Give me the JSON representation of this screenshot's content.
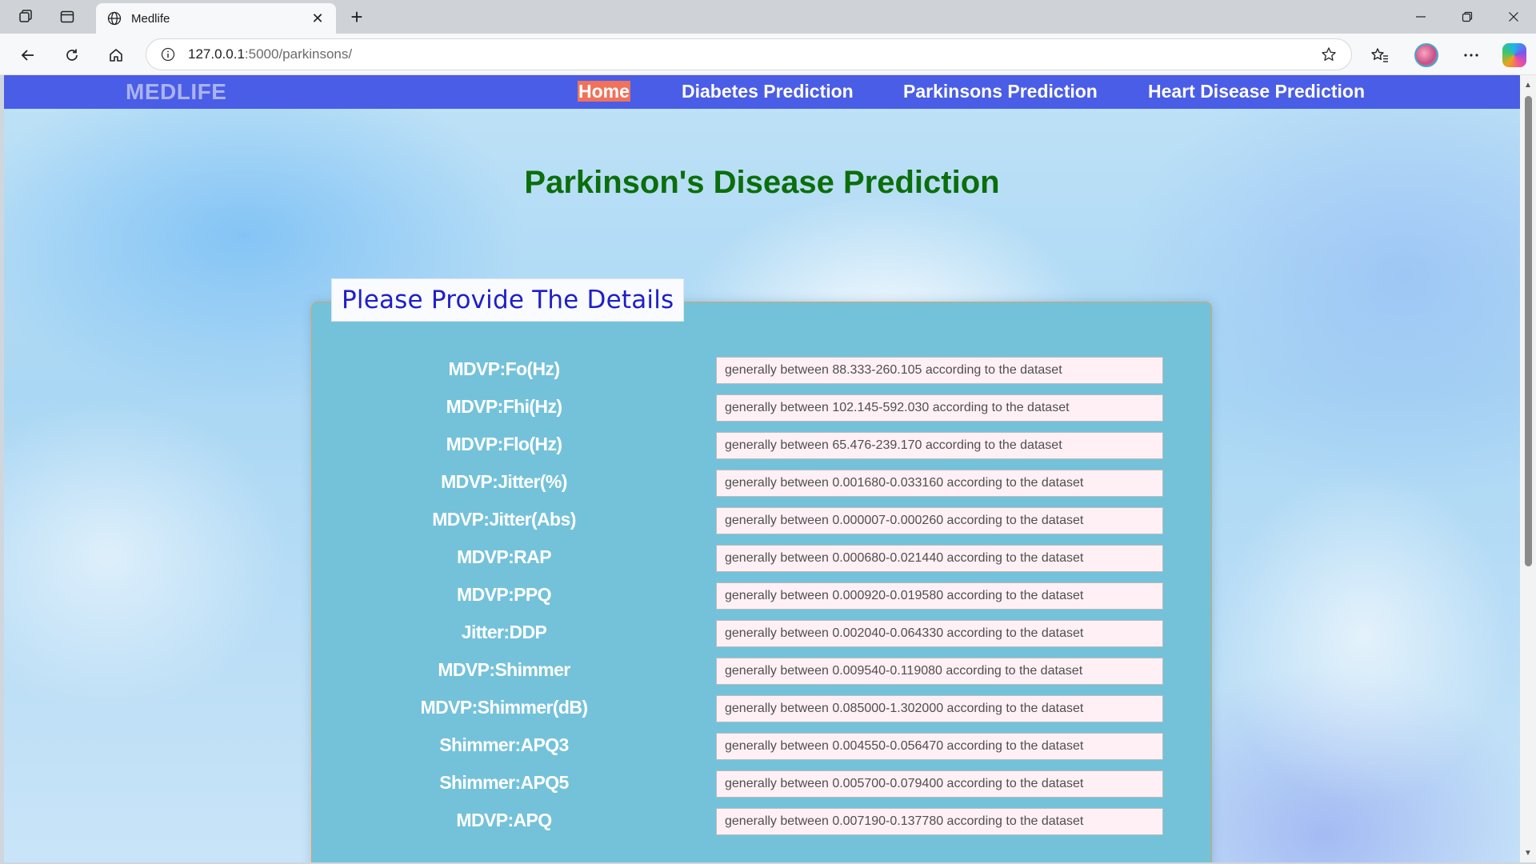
{
  "browser": {
    "tab_title": "Medlife",
    "url_host": "127.0.0.1",
    "url_rest": ":5000/parkinsons/",
    "new_tab_symbol": "+",
    "close_symbol": "✕"
  },
  "nav": {
    "brand": "MEDLIFE",
    "links": [
      "Home",
      "Diabetes Prediction",
      "Parkinsons Prediction",
      "Heart Disease Prediction"
    ]
  },
  "page": {
    "title": "Parkinson's Disease Prediction",
    "form_legend": "Please Provide The Details"
  },
  "fields": [
    {
      "label": "MDVP:Fo(Hz)",
      "placeholder": "generally between 88.333-260.105 according to the dataset"
    },
    {
      "label": "MDVP:Fhi(Hz)",
      "placeholder": "generally between 102.145-592.030 according to the dataset"
    },
    {
      "label": "MDVP:Flo(Hz)",
      "placeholder": "generally between 65.476-239.170 according to the dataset"
    },
    {
      "label": "MDVP:Jitter(%)",
      "placeholder": "generally between 0.001680-0.033160 according to the dataset"
    },
    {
      "label": "MDVP:Jitter(Abs)",
      "placeholder": "generally between 0.000007-0.000260 according to the dataset"
    },
    {
      "label": "MDVP:RAP",
      "placeholder": "generally between 0.000680-0.021440 according to the dataset"
    },
    {
      "label": "MDVP:PPQ",
      "placeholder": "generally between 0.000920-0.019580 according to the dataset"
    },
    {
      "label": "Jitter:DDP",
      "placeholder": "generally between 0.002040-0.064330 according to the dataset"
    },
    {
      "label": "MDVP:Shimmer",
      "placeholder": "generally between 0.009540-0.119080 according to the dataset"
    },
    {
      "label": "MDVP:Shimmer(dB)",
      "placeholder": "generally between 0.085000-1.302000 according to the dataset"
    },
    {
      "label": "Shimmer:APQ3",
      "placeholder": "generally between 0.004550-0.056470 according to the dataset"
    },
    {
      "label": "Shimmer:APQ5",
      "placeholder": "generally between 0.005700-0.079400 according to the dataset"
    },
    {
      "label": "MDVP:APQ",
      "placeholder": "generally between 0.007190-0.137780 according to the dataset"
    }
  ],
  "colors": {
    "navbar": "#4a5de6",
    "home_highlight": "#f0725a",
    "title_green": "#0b6e0b",
    "panel": "#74c2da",
    "legend_text": "#1f1fc8",
    "input_bg": "#fff0f5"
  }
}
